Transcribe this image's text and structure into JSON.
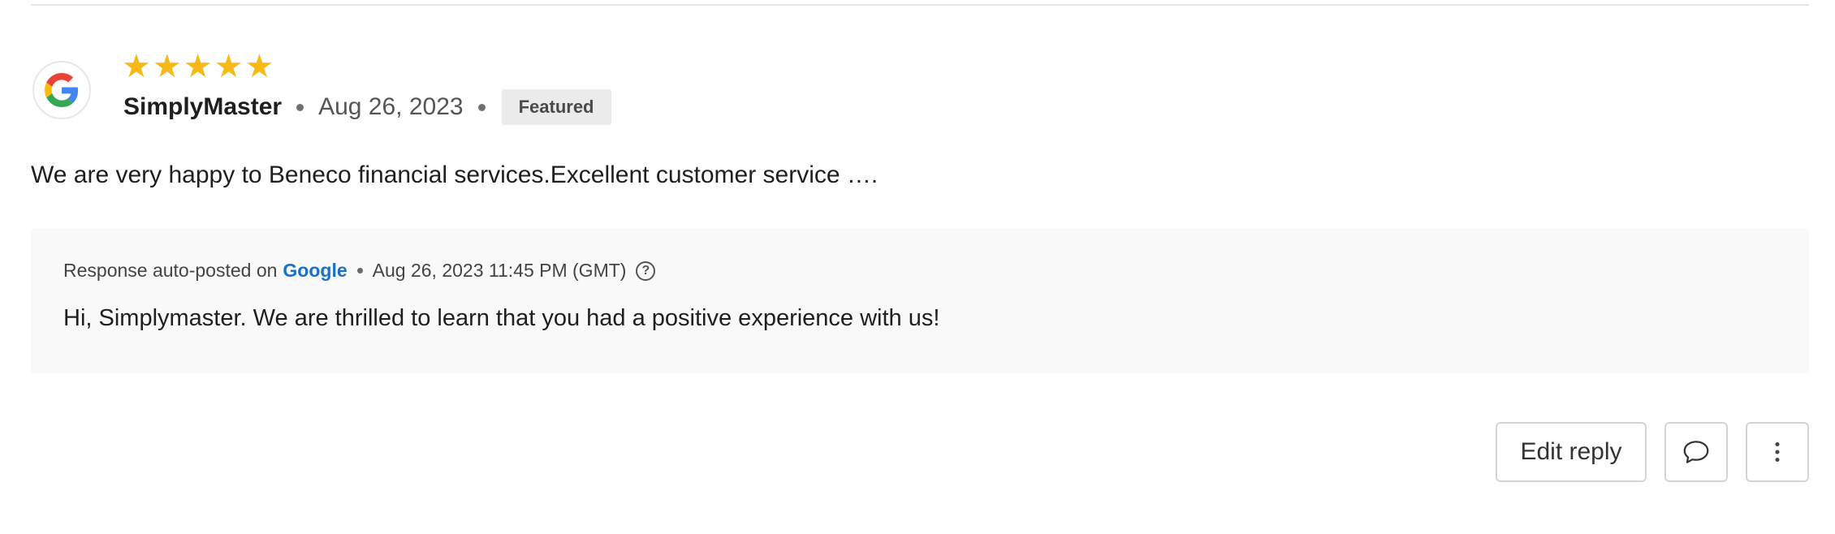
{
  "review": {
    "source_icon": "google-g-icon",
    "rating": 5,
    "rating_stars": "★★★★★",
    "reviewer": "SimplyMaster",
    "date": "Aug 26, 2023",
    "badge": "Featured",
    "text": "We are very happy to Beneco financial services.Excellent customer service …."
  },
  "response": {
    "prefix": "Response auto-posted on",
    "platform": "Google",
    "timestamp": "Aug 26, 2023 11:45 PM (GMT)",
    "help_icon_glyph": "?",
    "text": "Hi, Simplymaster. We are thrilled to learn that you had a positive experience with us!"
  },
  "actions": {
    "edit_label": "Edit reply",
    "comment_icon": "speech-bubble-icon",
    "more_icon": "vertical-dots-icon"
  },
  "colors": {
    "star": "#f7b916",
    "google_link": "#1a6fc9",
    "response_bg": "#f9f9f9",
    "badge_bg": "#ebebeb"
  }
}
